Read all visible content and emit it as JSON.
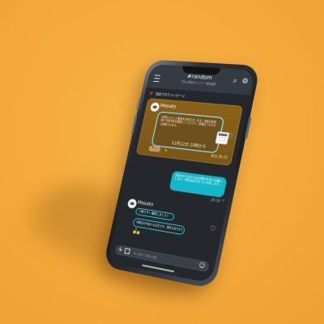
{
  "header": {
    "channel": "#random",
    "subtitle": "1% LINAメンバー/参加制"
  },
  "pinned": {
    "label": "固定されたメッセージ"
  },
  "highlight_post": {
    "sender": "Masato",
    "quote": "今週のトピック更新をお知らせします。会議の議事録と次回予定を確認してください。詳細はこちらから参照できます。",
    "event": "12月12日 15時から",
    "reaction_count": "1",
    "reaction_emoji": "❤",
    "edit_note": "✎",
    "timestamp": "昨日 20:15"
  },
  "outgoing_message": {
    "text": "次回の打ち合わせは月曜の午後でお願いします。資料は前日までに共有します。",
    "time": "20:16",
    "status_icon": "✓"
  },
  "reply_post": {
    "sender": "Masato",
    "line1": "了解です！確認しました！",
    "line2": "月曜日の午後で大丈夫です。資料もありがとう",
    "reaction": "🙂🙂"
  },
  "composer": {
    "placeholder": "メッセージを入力"
  },
  "icons": {
    "menu": "menu-icon",
    "search": "search-icon",
    "settings": "gear-icon",
    "pin": "pin-icon",
    "calendar": "calendar-icon",
    "heart": "heart-icon",
    "plus": "plus-icon",
    "image": "image-icon",
    "emoji": "emoji-icon"
  },
  "colors": {
    "background": "#f4a93a",
    "header": "#353b42",
    "highlight": "#7a5718",
    "accent": "#12b7c8",
    "screen": "#24282d"
  }
}
